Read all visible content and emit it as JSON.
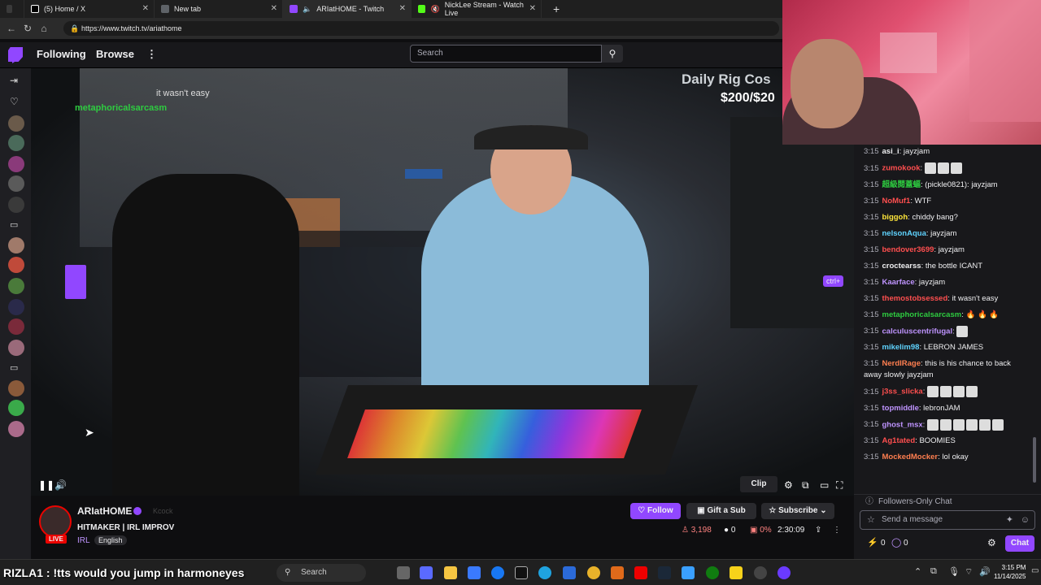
{
  "browser": {
    "tabs": [
      {
        "label": "(5) Home / X",
        "color": "#ffffff"
      },
      {
        "label": "New tab",
        "color": "#8ab4f8"
      },
      {
        "label": "ARIatHOME - Twitch",
        "color": "#9147ff"
      },
      {
        "label": "NickLee Stream - Watch Live",
        "color": "#53fc18"
      }
    ],
    "new_tab": "+",
    "url": "https://www.twitch.tv/ariathome"
  },
  "twitch": {
    "nav": {
      "following": "Following",
      "browse": "Browse",
      "more": "⋮",
      "search_placeholder": "Search"
    },
    "video_overlay": {
      "chat_line1": "it wasn't easy",
      "chat_user": "metaphoricalsarcasm",
      "rig_title": "Daily Rig Cos",
      "rig_value": "$200/$20",
      "ctrl_label": "ctrl+"
    },
    "player": {
      "clip": "Clip"
    },
    "stream": {
      "channel": "ARIatHOME",
      "kick_label": "Kcock",
      "title": "HITMAKER | IRL IMPROV",
      "category": "IRL",
      "tag": "English",
      "live": "LIVE",
      "follow": "Follow",
      "gift": "Gift a Sub",
      "subscribe": "Subscribe",
      "viewers": "3,198",
      "chat_count": "0",
      "pct": "0%",
      "uptime": "2:30:09"
    },
    "chat": {
      "messages": [
        {
          "time": "3:15",
          "user": "asi_i",
          "color": "#efeff1",
          "text": "jayzjam"
        },
        {
          "time": "3:15",
          "user": "zumokook",
          "color": "#ff4f4f",
          "text": "",
          "emotes": 3
        },
        {
          "time": "3:15",
          "user": "超級閱蓋蝠",
          "color": "#2ecc40",
          "text": "(pickle0821): jayzjam"
        },
        {
          "time": "3:15",
          "user": "NoMuf1",
          "color": "#ff4f4f",
          "text": "WTF"
        },
        {
          "time": "3:15",
          "user": "biggoh",
          "color": "#ffe63b",
          "text": "chiddy bang?"
        },
        {
          "time": "3:15",
          "user": "nelsonAqua",
          "color": "#5fd3ff",
          "text": "jayzjam"
        },
        {
          "time": "3:15",
          "user": "bendover3699",
          "color": "#ff4f4f",
          "text": "jayzjam"
        },
        {
          "time": "3:15",
          "user": "croctearss",
          "color": "#efeff1",
          "text": "the bottle ICANT"
        },
        {
          "time": "3:15",
          "user": "Kaarface",
          "color": "#bf94ff",
          "text": "jayzjam"
        },
        {
          "time": "3:15",
          "user": "themostobsessed",
          "color": "#ff4f4f",
          "text": "it wasn't easy"
        },
        {
          "time": "3:15",
          "user": "metaphoricalsarcasm",
          "color": "#2ecc40",
          "text": "🔥 🔥 🔥"
        },
        {
          "time": "3:15",
          "user": "calculuscentrifugal",
          "color": "#bf94ff",
          "text": "",
          "emotes": 1
        },
        {
          "time": "3:15",
          "user": "mikelim98",
          "color": "#5fd3ff",
          "text": "LEBRON JAMES"
        },
        {
          "time": "3:15",
          "user": "NerdIRage",
          "color": "#ff7f50",
          "text": "this is his chance to back away slowly jayzjam"
        },
        {
          "time": "3:15",
          "user": "j3ss_slicka",
          "color": "#ff4f4f",
          "text": "",
          "emotes": 4
        },
        {
          "time": "3:15",
          "user": "topmiddle",
          "color": "#bf94ff",
          "text": "lebronJAM"
        },
        {
          "time": "3:15",
          "user": "ghost_msx",
          "color": "#bf94ff",
          "text": "",
          "emotes": 6
        },
        {
          "time": "3:15",
          "user": "Ag1tated",
          "color": "#ff4f4f",
          "text": "BOOMIES"
        },
        {
          "time": "3:15",
          "user": "MockedMocker",
          "color": "#ff7f50",
          "text": "lol okay"
        }
      ],
      "followers_only": "Followers-Only Chat",
      "input_placeholder": "Send a message",
      "points1": "0",
      "points2": "0",
      "chat_button": "Chat"
    }
  },
  "taskbar": {
    "ticker": "RIZLA1 : !tts would you jump in harmoneyes",
    "search": "Search",
    "time": "3:15 PM",
    "date": "11/14/2025"
  }
}
